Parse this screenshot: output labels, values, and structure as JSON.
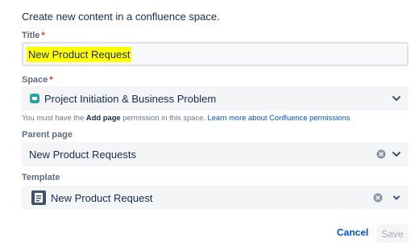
{
  "intro": "Create new content in a confluence space.",
  "title_field": {
    "label": "Title",
    "required_mark": "*",
    "value": "New Product Request"
  },
  "space_field": {
    "label": "Space",
    "required_mark": "*",
    "value": "Project Initiation & Business Problem",
    "icon": "space-icon",
    "icon_color": "#2aa59a"
  },
  "permission_hint": {
    "prefix": "You must have the ",
    "bold": "Add page",
    "middle": " permission in this space. ",
    "link": "Learn more about Confluence permissions"
  },
  "parent_field": {
    "label": "Parent page",
    "value": "New Product Requests"
  },
  "template_field": {
    "label": "Template",
    "value": "New Product Request",
    "icon": "template-icon"
  },
  "actions": {
    "cancel": "Cancel",
    "save": "Save"
  },
  "colors": {
    "highlight": "#ffff00",
    "link": "#0052cc",
    "required": "#de350b"
  }
}
